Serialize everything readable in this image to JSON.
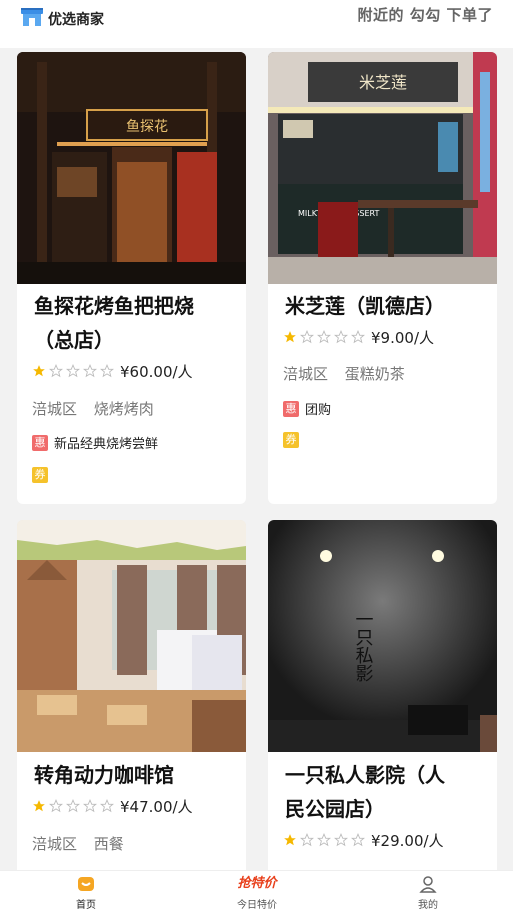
{
  "header": {
    "title": "优选商家",
    "right_text": "附近的 勾勾 下单了"
  },
  "cards": [
    {
      "name": "鱼探花烤鱼把把烧（总店）",
      "name_line1": "鱼探花烤鱼把把烧",
      "name_line2": "（总店）",
      "rating": 1,
      "price": "¥60.00/人",
      "district": "涪城区",
      "category": "烧烤烤肉",
      "hui_badge": "惠",
      "hui_text": "新品经典烧烤尝鲜",
      "quan_badge": "券",
      "sign_text": "鱼探花"
    },
    {
      "name": "米芝莲（凯德店）",
      "rating": 1,
      "price": "¥9.00/人",
      "district": "涪城区",
      "category": "蛋糕奶茶",
      "hui_badge": "惠",
      "hui_text": "团购",
      "quan_badge": "券",
      "sign_text": "米芝莲",
      "counter_text": "MILKTEA & DESSERT"
    },
    {
      "name": "转角动力咖啡馆",
      "rating": 1,
      "price": "¥47.00/人",
      "district": "涪城区",
      "category": "西餐"
    },
    {
      "name": "一只私人影院（人民公园店）",
      "name_line1": "一只私人影院（人",
      "name_line2": "民公园店）",
      "rating": 1,
      "price": "¥29.00/人",
      "wall_text": "一只私影"
    }
  ],
  "bottom_nav": {
    "home": "首页",
    "today": "今日特价",
    "today_logo": "抢特价",
    "mine": "我的"
  },
  "colors": {
    "hui_badge": "#f06b6b",
    "quan_badge": "#f5c22b",
    "star_filled": "#f5b800",
    "nav_active": "#f5a623"
  },
  "icons": {
    "header": "shop-icon",
    "home": "home-icon",
    "mine": "user-icon"
  }
}
